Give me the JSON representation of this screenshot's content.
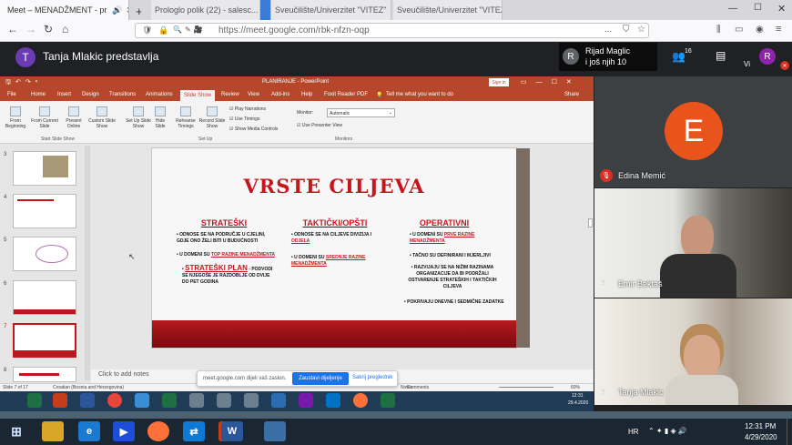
{
  "browser": {
    "tabs": [
      {
        "label": "Meet – MENADŽMENT - pr"
      },
      {
        "label": "Prologlo polik (22) - salesc..."
      },
      {
        "label": ""
      },
      {
        "label": "Sveučilište/Univerzitet \"VITEZ\""
      },
      {
        "label": "Sveučilište/Univerzitet \"VITEZ\""
      }
    ],
    "url": "https://meet.google.com/rbk-nfzn-oqp",
    "menu_dots": "..."
  },
  "meet": {
    "presenter_initial": "T",
    "presenter_text": "Tanja Mlakic predstavlja",
    "pinned_initial": "R",
    "pinned_name": "Rijad Maglic",
    "pinned_more": "i još njih 10",
    "people_count": "16",
    "vi_label": "Vi",
    "self_initial": "R",
    "participants": [
      {
        "name": "Edina Memić",
        "initial": "E",
        "muted": true
      },
      {
        "name": "Emir Bektaš",
        "muted": false
      },
      {
        "name": "Tanja Mlakic",
        "muted": false
      }
    ],
    "share_banner": {
      "text": "meet.google.com dijeli vaš zaslon.",
      "stop_label": "Zaustavi dijeljenje",
      "hide_label": "Sakrij preglednik"
    }
  },
  "ppt": {
    "title": "PLANIRANJE - PowerPoint",
    "signin": "Sign in",
    "tabs": [
      "File",
      "Home",
      "Insert",
      "Design",
      "Transitions",
      "Animations",
      "Slide Show",
      "Review",
      "View",
      "Add-ins",
      "Help",
      "Foxit Reader PDF",
      "Tell me what you want to do",
      "Share"
    ],
    "active_tab": "Slide Show",
    "ribbon": {
      "start_buttons": [
        "From Beginning",
        "From Current Slide",
        "Present Online",
        "Custom Slide Show"
      ],
      "start_group": "Start Slide Show",
      "setup_buttons": [
        "Set Up Slide Show",
        "Hide Slide",
        "Rehearse Timings",
        "Record Slide Show"
      ],
      "checks": [
        "Play Narrations",
        "Use Timings",
        "Show Media Controls"
      ],
      "setup_group": "Set Up",
      "monitor_label": "Monitor:",
      "monitor_value": "Automatic",
      "presenter_view": "Use Presenter View",
      "monitors_group": "Monitors"
    },
    "thumb_numbers": [
      "3",
      "4",
      "5",
      "6",
      "7",
      "8"
    ],
    "slide": {
      "title": "VRSTE CILJEVA",
      "col1": {
        "heading": "STRATEŠKI",
        "b1": "ODNOSE SE NA PODRUČJE U CJELINI, GDJE ONO ŽELI BITI U BUDUĆNOSTI",
        "b2a": "U DOMENI SU ",
        "b2b": "TOP RAZINE MENADŽMENTA",
        "b3": "STRATEŠKI PLAN",
        "b3b": " - PODVODI SE NJEGOŠE JE RAZDOBLJE OD DVIJE DO PET GODINA"
      },
      "col2": {
        "heading": "TAKTIČKI/OPŠTI",
        "b1a": "ODNOSE SE NA CILJEVE DIVIZIJA I ",
        "b1b": "ODJELA",
        "b2a": "U DOMENI SU ",
        "b2b": "SREDNJE RAZINE MENADŽMENTA"
      },
      "col3": {
        "heading": "OPERATIVNI",
        "b1a": "U DOMENI SU ",
        "b1b": "PRVE RAZINE MENADŽMENTA",
        "b2": "TAČNO SU DEFINIRANI I MJERLJIVI",
        "b3": "RAZVIJAJU SE NA NIŽIM RAZINAMA ORGANIZACIJE DA BI PODRŽALI OSTVARENJE STRATEŠKIH I TAKTIČKIH CILJEVA",
        "b4": "POKRIVAJU DNEVNE I SEDMIČNE ZADATKE"
      }
    },
    "notes_placeholder": "Click to add notes",
    "status": {
      "slide": "Slide 7 of 17",
      "language": "Croatian (Bosnia and Herzegovina)",
      "notes": "Notes",
      "comments": "Comments",
      "zoom": "60%"
    },
    "inner_clock": "12:31",
    "inner_date": "29.4.2020"
  },
  "taskbar": {
    "lang": "HR",
    "time": "12:31 PM",
    "date": "4/29/2020"
  }
}
